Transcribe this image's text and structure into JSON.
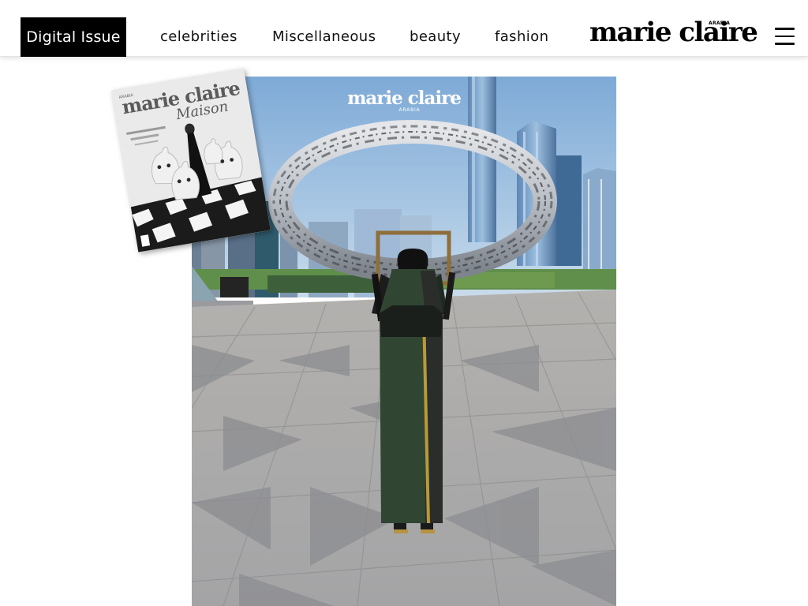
{
  "header": {
    "digital_issue": "Digital Issue",
    "nav": [
      "celebrities",
      "Miscellaneous",
      "beauty",
      "fashion"
    ],
    "logo": "marie claire",
    "logo_sub": "ARABIA",
    "menu_icon": "hamburger-icon"
  },
  "cover": {
    "masthead": "marie claire",
    "masthead_sub": "ARABIA",
    "colors": {
      "sky": "#8fb9e0",
      "tile_dark": "#8e8f93",
      "tile_light": "#cbc9c6",
      "abaya": "#2f4633"
    }
  },
  "thumbnail": {
    "masthead": "marie claire",
    "sub": "Maison",
    "badge": "ARABIA"
  }
}
